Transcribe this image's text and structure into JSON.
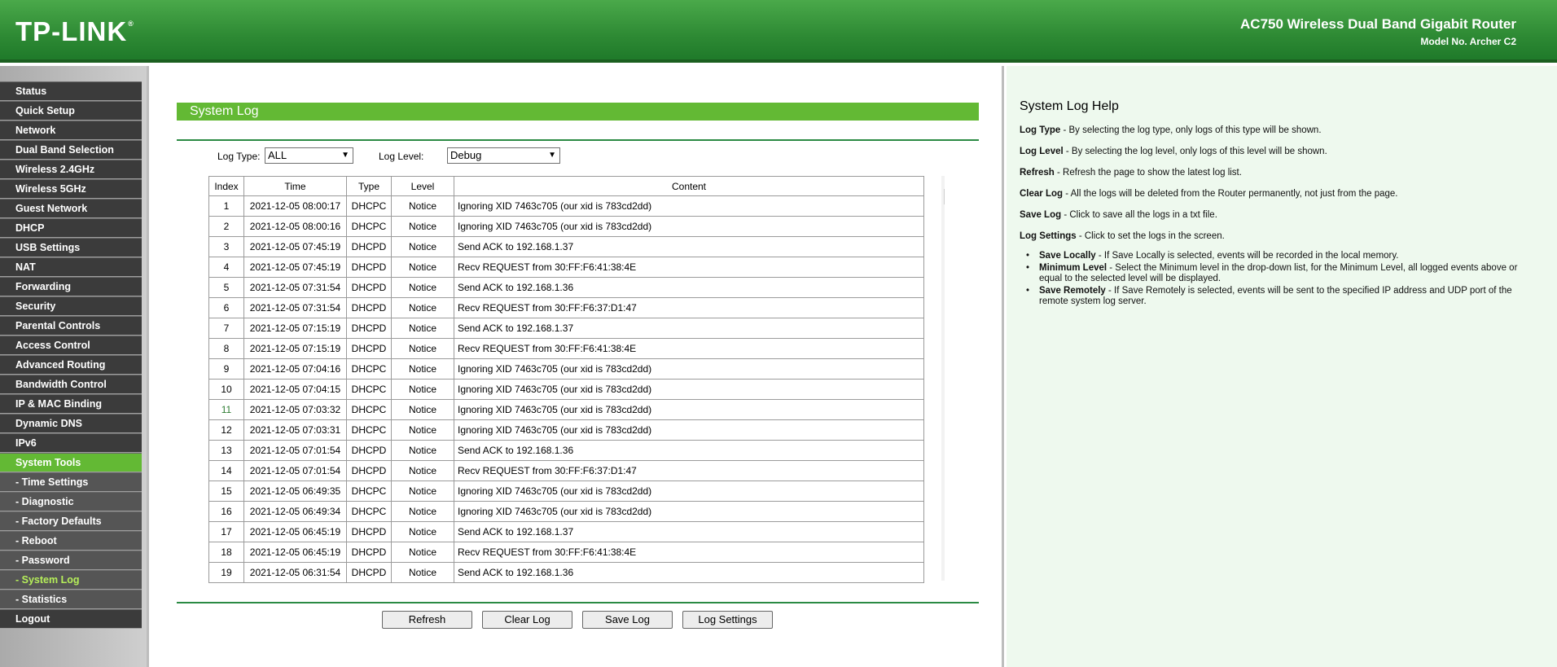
{
  "header": {
    "logo": "TP-LINK",
    "logo_mark": "®",
    "product_name": "AC750 Wireless Dual Band Gigabit Router",
    "model": "Model No. Archer C2"
  },
  "sidebar": {
    "items": [
      {
        "label": "Status"
      },
      {
        "label": "Quick Setup"
      },
      {
        "label": "Network"
      },
      {
        "label": "Dual Band Selection"
      },
      {
        "label": "Wireless 2.4GHz"
      },
      {
        "label": "Wireless 5GHz"
      },
      {
        "label": "Guest Network"
      },
      {
        "label": "DHCP"
      },
      {
        "label": "USB Settings"
      },
      {
        "label": "NAT"
      },
      {
        "label": "Forwarding"
      },
      {
        "label": "Security"
      },
      {
        "label": "Parental Controls"
      },
      {
        "label": "Access Control"
      },
      {
        "label": "Advanced Routing"
      },
      {
        "label": "Bandwidth Control"
      },
      {
        "label": "IP & MAC Binding"
      },
      {
        "label": "Dynamic DNS"
      },
      {
        "label": "IPv6"
      },
      {
        "label": "System Tools"
      },
      {
        "label": "- Time Settings"
      },
      {
        "label": "- Diagnostic"
      },
      {
        "label": "- Factory Defaults"
      },
      {
        "label": "- Reboot"
      },
      {
        "label": "- Password"
      },
      {
        "label": "- System Log"
      },
      {
        "label": "- Statistics"
      },
      {
        "label": "Logout"
      }
    ]
  },
  "main": {
    "title": "System Log",
    "log_type_label": "Log Type:",
    "log_type_value": "ALL",
    "log_level_label": "Log Level:",
    "log_level_value": "Debug",
    "columns": [
      "Index",
      "Time",
      "Type",
      "Level",
      "Content"
    ],
    "rows": [
      {
        "index": "1",
        "time": "2021-12-05 08:00:17",
        "type": "DHCPC",
        "level": "Notice",
        "content": "Ignoring XID 7463c705 (our xid is 783cd2dd)"
      },
      {
        "index": "2",
        "time": "2021-12-05 08:00:16",
        "type": "DHCPC",
        "level": "Notice",
        "content": "Ignoring XID 7463c705 (our xid is 783cd2dd)"
      },
      {
        "index": "3",
        "time": "2021-12-05 07:45:19",
        "type": "DHCPD",
        "level": "Notice",
        "content": "Send ACK to 192.168.1.37"
      },
      {
        "index": "4",
        "time": "2021-12-05 07:45:19",
        "type": "DHCPD",
        "level": "Notice",
        "content": "Recv REQUEST from 30:FF:F6:41:38:4E"
      },
      {
        "index": "5",
        "time": "2021-12-05 07:31:54",
        "type": "DHCPD",
        "level": "Notice",
        "content": "Send ACK to 192.168.1.36"
      },
      {
        "index": "6",
        "time": "2021-12-05 07:31:54",
        "type": "DHCPD",
        "level": "Notice",
        "content": "Recv REQUEST from 30:FF:F6:37:D1:47"
      },
      {
        "index": "7",
        "time": "2021-12-05 07:15:19",
        "type": "DHCPD",
        "level": "Notice",
        "content": "Send ACK to 192.168.1.37"
      },
      {
        "index": "8",
        "time": "2021-12-05 07:15:19",
        "type": "DHCPD",
        "level": "Notice",
        "content": "Recv REQUEST from 30:FF:F6:41:38:4E"
      },
      {
        "index": "9",
        "time": "2021-12-05 07:04:16",
        "type": "DHCPC",
        "level": "Notice",
        "content": "Ignoring XID 7463c705 (our xid is 783cd2dd)"
      },
      {
        "index": "10",
        "time": "2021-12-05 07:04:15",
        "type": "DHCPC",
        "level": "Notice",
        "content": "Ignoring XID 7463c705 (our xid is 783cd2dd)"
      },
      {
        "index": "11",
        "time": "2021-12-05 07:03:32",
        "type": "DHCPC",
        "level": "Notice",
        "content": "Ignoring XID 7463c705 (our xid is 783cd2dd)"
      },
      {
        "index": "12",
        "time": "2021-12-05 07:03:31",
        "type": "DHCPC",
        "level": "Notice",
        "content": "Ignoring XID 7463c705 (our xid is 783cd2dd)"
      },
      {
        "index": "13",
        "time": "2021-12-05 07:01:54",
        "type": "DHCPD",
        "level": "Notice",
        "content": "Send ACK to 192.168.1.36"
      },
      {
        "index": "14",
        "time": "2021-12-05 07:01:54",
        "type": "DHCPD",
        "level": "Notice",
        "content": "Recv REQUEST from 30:FF:F6:37:D1:47"
      },
      {
        "index": "15",
        "time": "2021-12-05 06:49:35",
        "type": "DHCPC",
        "level": "Notice",
        "content": "Ignoring XID 7463c705 (our xid is 783cd2dd)"
      },
      {
        "index": "16",
        "time": "2021-12-05 06:49:34",
        "type": "DHCPC",
        "level": "Notice",
        "content": "Ignoring XID 7463c705 (our xid is 783cd2dd)"
      },
      {
        "index": "17",
        "time": "2021-12-05 06:45:19",
        "type": "DHCPD",
        "level": "Notice",
        "content": "Send ACK to 192.168.1.37"
      },
      {
        "index": "18",
        "time": "2021-12-05 06:45:19",
        "type": "DHCPD",
        "level": "Notice",
        "content": "Recv REQUEST from 30:FF:F6:41:38:4E"
      },
      {
        "index": "19",
        "time": "2021-12-05 06:31:54",
        "type": "DHCPD",
        "level": "Notice",
        "content": "Send ACK to 192.168.1.36"
      }
    ],
    "buttons": {
      "refresh": "Refresh",
      "clear_log": "Clear Log",
      "save_log": "Save Log",
      "log_settings": "Log Settings"
    }
  },
  "help": {
    "title": "System Log Help",
    "log_type_term": "Log Type",
    "log_type_text": " - By selecting the log type, only logs of this type will be shown.",
    "log_level_term": "Log Level",
    "log_level_text": " - By selecting the log level, only logs of this level will be shown.",
    "refresh_term": "Refresh",
    "refresh_text": " - Refresh the page to show the latest log list.",
    "clear_term": "Clear Log",
    "clear_text": " - All the logs will be deleted from the Router permanently, not just from the page.",
    "save_term": "Save Log",
    "save_text": " - Click to save all the logs in a txt file.",
    "settings_term": "Log Settings",
    "settings_text": " - Click to set the logs in the screen.",
    "bullets": [
      {
        "term": "Save Locally",
        "text": " - If Save Locally is selected, events will be recorded in the local memory."
      },
      {
        "term": "Minimum Level",
        "text": " - Select the Minimum level in the drop-down list, for the Minimum Level, all logged events above or equal to the selected level will be displayed."
      },
      {
        "term": "Save Remotely",
        "text": " - If Save Remotely is selected, events will be sent to the specified IP address and UDP port of the remote system log server."
      }
    ]
  },
  "colors": {
    "header_green": "#2e8a34",
    "accent_green": "#63b934",
    "menu_dark": "#3b3b3b",
    "menu_sub": "#555555",
    "help_bg": "#eef9ee"
  }
}
